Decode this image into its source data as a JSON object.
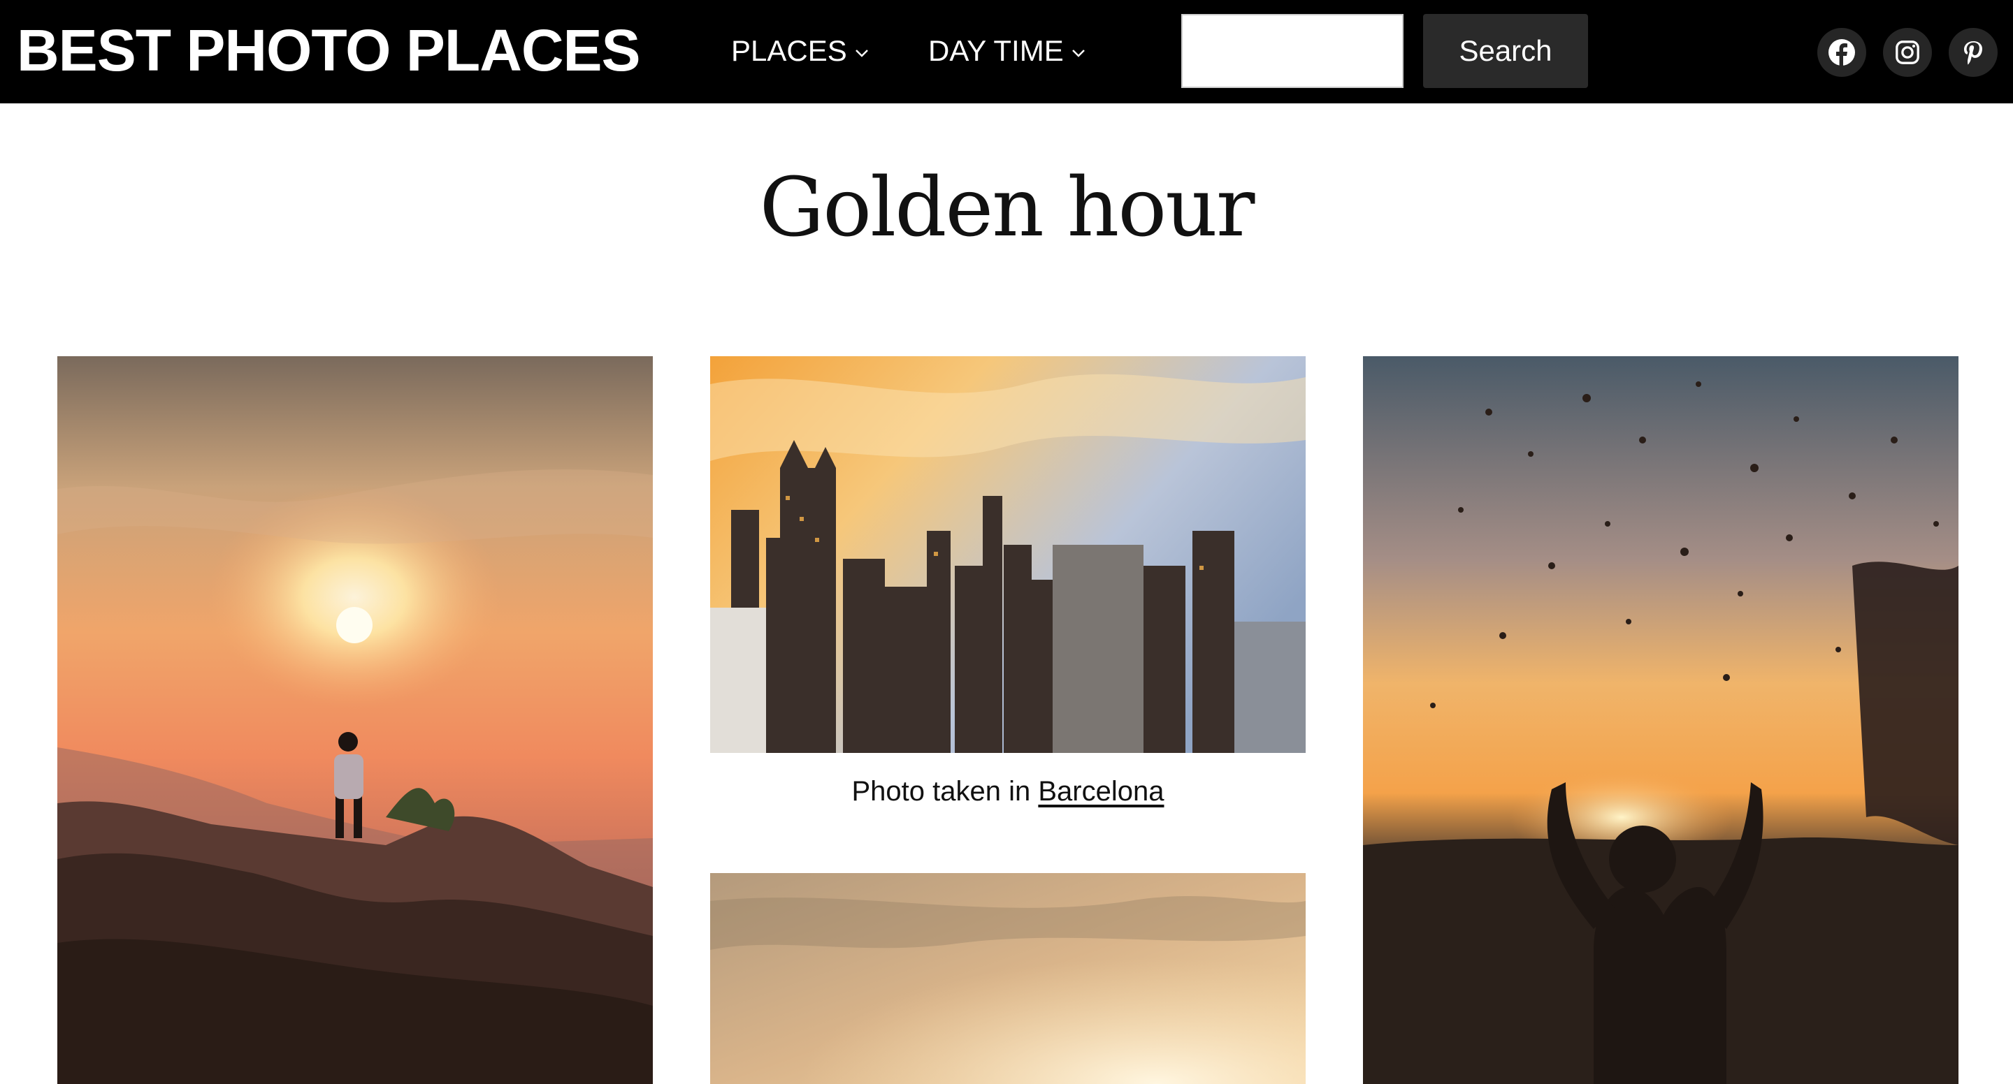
{
  "header": {
    "site_title": "BEST PHOTO PLACES",
    "nav": [
      {
        "label": "PLACES"
      },
      {
        "label": "DAY TIME"
      }
    ],
    "search": {
      "value": "",
      "button_label": "Search"
    },
    "social": [
      {
        "icon": "facebook-icon"
      },
      {
        "icon": "instagram-icon"
      },
      {
        "icon": "pinterest-icon"
      }
    ],
    "background_color": "#000000"
  },
  "main": {
    "page_title": "Golden hour",
    "photos": [
      {
        "icon": "mountain-sunset-photo"
      },
      {
        "icon": "city-skyline-photo",
        "caption_prefix": "Photo taken in ",
        "caption_link": "Barcelona"
      },
      {
        "icon": "water-splash-sunset-photo"
      },
      {
        "icon": "golden-sky-photo"
      }
    ]
  }
}
